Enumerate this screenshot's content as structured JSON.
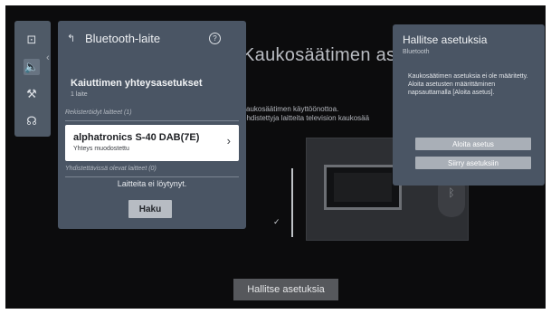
{
  "background": {
    "title": "Kaukosäätimen asetukset",
    "description_line1": "kaukosäätimen käyttöönottoa.",
    "description_line2": "ohdistettyja laitteita television kaukosää",
    "check_mark": "✓",
    "bottom_button": "Hallitse asetuksia",
    "remote_glyph": "ᛒ"
  },
  "rail": {
    "items": [
      {
        "icon": "picture-settings-icon",
        "glyph": "⊡"
      },
      {
        "icon": "speaker-icon",
        "glyph": "🔈"
      },
      {
        "icon": "wrench-icon",
        "glyph": "⚒"
      },
      {
        "icon": "headset-icon",
        "glyph": "☊"
      }
    ],
    "arrow": "‹"
  },
  "bluetooth_panel": {
    "back_glyph": "↰",
    "title": "Bluetooth-laite",
    "help_glyph": "?",
    "speaker_section_title": "Kaiuttimen yhteysasetukset",
    "speaker_section_sub": "1 laite",
    "registered_header": "Rekisteröidyt laitteet (1)",
    "device": {
      "name": "alphatronics S-40 DAB(7E)",
      "status": "Yhteys muodostettu",
      "chevron": "›"
    },
    "available_header": "Yhdistettävissä olevat laitteet (0)",
    "no_devices_text": "Laitteita ei löytynyt.",
    "search_button": "Haku"
  },
  "popup": {
    "title": "Hallitse asetuksia",
    "subtitle": "Bluetooth",
    "body": "Kaukosäätimen asetuksia ei ole määritetty. Aloita asetusten määrittäminen napsauttamalla [Aloita asetus].",
    "start_button": "Aloita asetus",
    "goto_button": "Siirry asetuksiin"
  },
  "colors": {
    "panel": "#4a5564",
    "rail": "#4f5a67",
    "screen": "#0c0c0d"
  }
}
